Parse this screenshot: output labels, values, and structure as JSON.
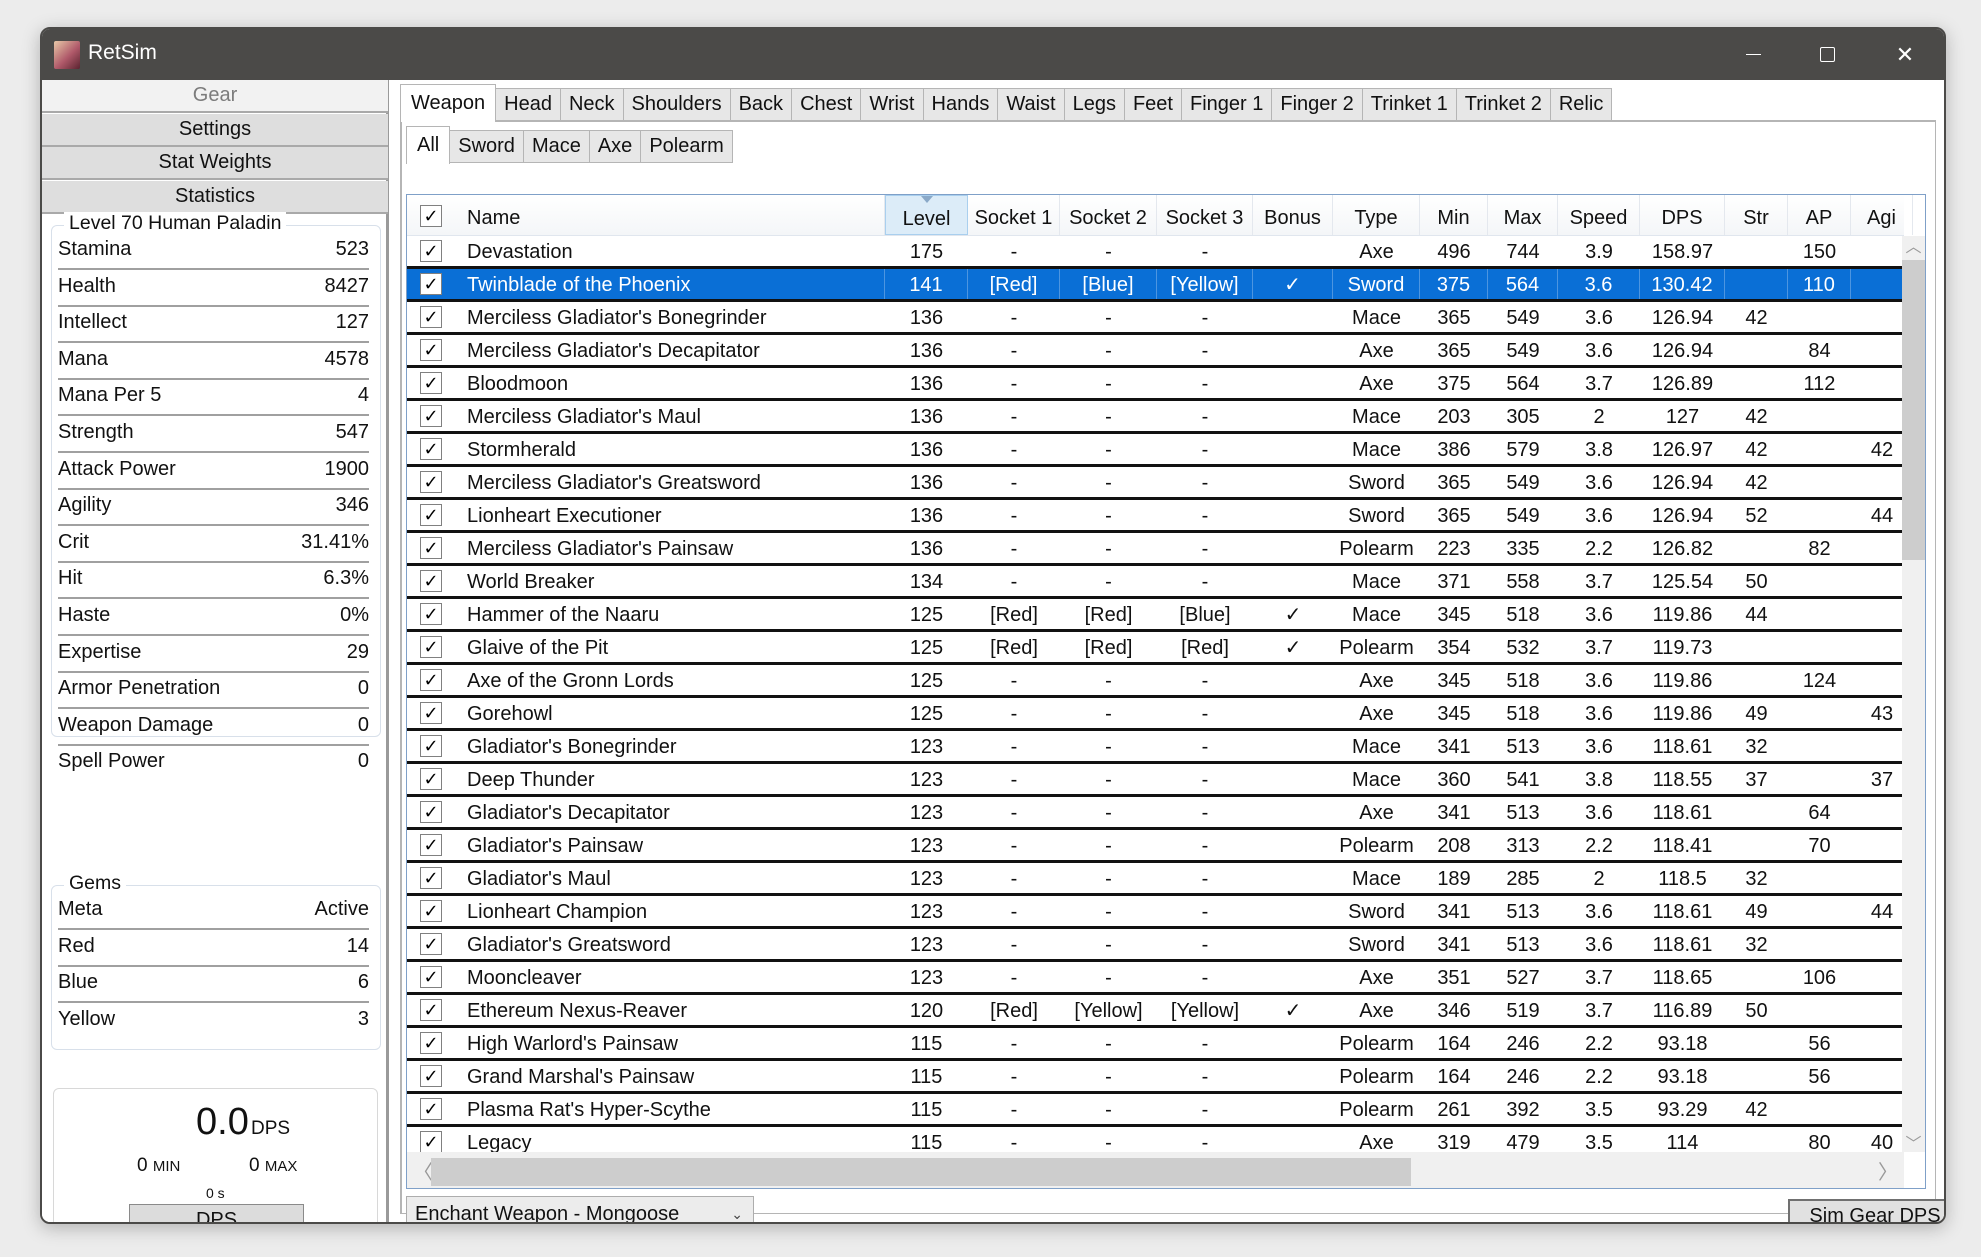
{
  "window": {
    "title": "RetSim",
    "controls": [
      "minimize",
      "maximize",
      "close"
    ]
  },
  "sidebar": {
    "nav": [
      {
        "label": "Gear",
        "active": true
      },
      {
        "label": "Settings",
        "active": false
      },
      {
        "label": "Stat Weights",
        "active": false
      },
      {
        "label": "Statistics",
        "active": false
      }
    ],
    "character": {
      "title": "Level 70 Human Paladin",
      "stats": [
        {
          "label": "Stamina",
          "value": "523"
        },
        {
          "label": "Health",
          "value": "8427"
        },
        {
          "label": "Intellect",
          "value": "127"
        },
        {
          "label": "Mana",
          "value": "4578"
        },
        {
          "label": "Mana Per 5",
          "value": "4"
        },
        {
          "label": "Strength",
          "value": "547"
        },
        {
          "label": "Attack Power",
          "value": "1900"
        },
        {
          "label": "Agility",
          "value": "346"
        },
        {
          "label": "Crit",
          "value": "31.41%"
        },
        {
          "label": "Hit",
          "value": "6.3%"
        },
        {
          "label": "Haste",
          "value": "0%"
        },
        {
          "label": "Expertise",
          "value": "29"
        },
        {
          "label": "Armor Penetration",
          "value": "0"
        },
        {
          "label": "Weapon Damage",
          "value": "0"
        },
        {
          "label": "Spell Power",
          "value": "0"
        }
      ]
    },
    "gems": {
      "title": "Gems",
      "rows": [
        {
          "label": "Meta",
          "value": "Active"
        },
        {
          "label": "Red",
          "value": "14"
        },
        {
          "label": "Blue",
          "value": "6"
        },
        {
          "label": "Yellow",
          "value": "3"
        }
      ]
    },
    "dps": {
      "value": "0.0",
      "unit": "DPS",
      "min": "0",
      "min_label": "MIN",
      "max": "0",
      "max_label": "MAX",
      "time": "0 s",
      "button_label": "DPS"
    }
  },
  "main": {
    "slot_tabs": [
      {
        "label": "Weapon",
        "active": true
      },
      {
        "label": "Head"
      },
      {
        "label": "Neck"
      },
      {
        "label": "Shoulders"
      },
      {
        "label": "Back"
      },
      {
        "label": "Chest"
      },
      {
        "label": "Wrist"
      },
      {
        "label": "Hands"
      },
      {
        "label": "Waist"
      },
      {
        "label": "Legs"
      },
      {
        "label": "Feet"
      },
      {
        "label": "Finger 1"
      },
      {
        "label": "Finger 2"
      },
      {
        "label": "Trinket 1"
      },
      {
        "label": "Trinket 2"
      },
      {
        "label": "Relic"
      }
    ],
    "type_tabs": [
      {
        "label": "All",
        "active": true
      },
      {
        "label": "Sword"
      },
      {
        "label": "Mace"
      },
      {
        "label": "Axe"
      },
      {
        "label": "Polearm"
      }
    ],
    "table": {
      "header_checked": true,
      "sorted_column": "Level",
      "columns": [
        "Name",
        "Level",
        "Socket 1",
        "Socket 2",
        "Socket 3",
        "Bonus",
        "Type",
        "Min",
        "Max",
        "Speed",
        "DPS",
        "Str",
        "AP",
        "Agi"
      ],
      "selected_index": 1,
      "rows": [
        {
          "checked": true,
          "cells": [
            "Devastation",
            "175",
            "-",
            "-",
            "-",
            "",
            "Axe",
            "496",
            "744",
            "3.9",
            "158.97",
            "",
            "150",
            ""
          ]
        },
        {
          "checked": true,
          "cells": [
            "Twinblade of the Phoenix",
            "141",
            "[Red]",
            "[Blue]",
            "[Yellow]",
            "✓",
            "Sword",
            "375",
            "564",
            "3.6",
            "130.42",
            "",
            "110",
            ""
          ]
        },
        {
          "checked": true,
          "cells": [
            "Merciless Gladiator's Bonegrinder",
            "136",
            "-",
            "-",
            "-",
            "",
            "Mace",
            "365",
            "549",
            "3.6",
            "126.94",
            "42",
            "",
            ""
          ]
        },
        {
          "checked": true,
          "cells": [
            "Merciless Gladiator's Decapitator",
            "136",
            "-",
            "-",
            "-",
            "",
            "Axe",
            "365",
            "549",
            "3.6",
            "126.94",
            "",
            "84",
            ""
          ]
        },
        {
          "checked": true,
          "cells": [
            "Bloodmoon",
            "136",
            "-",
            "-",
            "-",
            "",
            "Axe",
            "375",
            "564",
            "3.7",
            "126.89",
            "",
            "112",
            ""
          ]
        },
        {
          "checked": true,
          "cells": [
            "Merciless Gladiator's Maul",
            "136",
            "-",
            "-",
            "-",
            "",
            "Mace",
            "203",
            "305",
            "2",
            "127",
            "42",
            "",
            ""
          ]
        },
        {
          "checked": true,
          "cells": [
            "Stormherald",
            "136",
            "-",
            "-",
            "-",
            "",
            "Mace",
            "386",
            "579",
            "3.8",
            "126.97",
            "42",
            "",
            "42"
          ]
        },
        {
          "checked": true,
          "cells": [
            "Merciless Gladiator's Greatsword",
            "136",
            "-",
            "-",
            "-",
            "",
            "Sword",
            "365",
            "549",
            "3.6",
            "126.94",
            "42",
            "",
            ""
          ]
        },
        {
          "checked": true,
          "cells": [
            "Lionheart Executioner",
            "136",
            "-",
            "-",
            "-",
            "",
            "Sword",
            "365",
            "549",
            "3.6",
            "126.94",
            "52",
            "",
            "44"
          ]
        },
        {
          "checked": true,
          "cells": [
            "Merciless Gladiator's Painsaw",
            "136",
            "-",
            "-",
            "-",
            "",
            "Polearm",
            "223",
            "335",
            "2.2",
            "126.82",
            "",
            "82",
            ""
          ]
        },
        {
          "checked": true,
          "cells": [
            "World Breaker",
            "134",
            "-",
            "-",
            "-",
            "",
            "Mace",
            "371",
            "558",
            "3.7",
            "125.54",
            "50",
            "",
            ""
          ]
        },
        {
          "checked": true,
          "cells": [
            "Hammer of the Naaru",
            "125",
            "[Red]",
            "[Red]",
            "[Blue]",
            "✓",
            "Mace",
            "345",
            "518",
            "3.6",
            "119.86",
            "44",
            "",
            ""
          ]
        },
        {
          "checked": true,
          "cells": [
            "Glaive of the Pit",
            "125",
            "[Red]",
            "[Red]",
            "[Red]",
            "✓",
            "Polearm",
            "354",
            "532",
            "3.7",
            "119.73",
            "",
            "",
            ""
          ]
        },
        {
          "checked": true,
          "cells": [
            "Axe of the Gronn Lords",
            "125",
            "-",
            "-",
            "-",
            "",
            "Axe",
            "345",
            "518",
            "3.6",
            "119.86",
            "",
            "124",
            ""
          ]
        },
        {
          "checked": true,
          "cells": [
            "Gorehowl",
            "125",
            "-",
            "-",
            "-",
            "",
            "Axe",
            "345",
            "518",
            "3.6",
            "119.86",
            "49",
            "",
            "43"
          ]
        },
        {
          "checked": true,
          "cells": [
            "Gladiator's Bonegrinder",
            "123",
            "-",
            "-",
            "-",
            "",
            "Mace",
            "341",
            "513",
            "3.6",
            "118.61",
            "32",
            "",
            ""
          ]
        },
        {
          "checked": true,
          "cells": [
            "Deep Thunder",
            "123",
            "-",
            "-",
            "-",
            "",
            "Mace",
            "360",
            "541",
            "3.8",
            "118.55",
            "37",
            "",
            "37"
          ]
        },
        {
          "checked": true,
          "cells": [
            "Gladiator's Decapitator",
            "123",
            "-",
            "-",
            "-",
            "",
            "Axe",
            "341",
            "513",
            "3.6",
            "118.61",
            "",
            "64",
            ""
          ]
        },
        {
          "checked": true,
          "cells": [
            "Gladiator's Painsaw",
            "123",
            "-",
            "-",
            "-",
            "",
            "Polearm",
            "208",
            "313",
            "2.2",
            "118.41",
            "",
            "70",
            ""
          ]
        },
        {
          "checked": true,
          "cells": [
            "Gladiator's Maul",
            "123",
            "-",
            "-",
            "-",
            "",
            "Mace",
            "189",
            "285",
            "2",
            "118.5",
            "32",
            "",
            ""
          ]
        },
        {
          "checked": true,
          "cells": [
            "Lionheart Champion",
            "123",
            "-",
            "-",
            "-",
            "",
            "Sword",
            "341",
            "513",
            "3.6",
            "118.61",
            "49",
            "",
            "44"
          ]
        },
        {
          "checked": true,
          "cells": [
            "Gladiator's Greatsword",
            "123",
            "-",
            "-",
            "-",
            "",
            "Sword",
            "341",
            "513",
            "3.6",
            "118.61",
            "32",
            "",
            ""
          ]
        },
        {
          "checked": true,
          "cells": [
            "Mooncleaver",
            "123",
            "-",
            "-",
            "-",
            "",
            "Axe",
            "351",
            "527",
            "3.7",
            "118.65",
            "",
            "106",
            ""
          ]
        },
        {
          "checked": true,
          "cells": [
            "Ethereum Nexus-Reaver",
            "120",
            "[Red]",
            "[Yellow]",
            "[Yellow]",
            "✓",
            "Axe",
            "346",
            "519",
            "3.7",
            "116.89",
            "50",
            "",
            ""
          ]
        },
        {
          "checked": true,
          "cells": [
            "High Warlord's Painsaw",
            "115",
            "-",
            "-",
            "-",
            "",
            "Polearm",
            "164",
            "246",
            "2.2",
            "93.18",
            "",
            "56",
            ""
          ]
        },
        {
          "checked": true,
          "cells": [
            "Grand Marshal's Painsaw",
            "115",
            "-",
            "-",
            "-",
            "",
            "Polearm",
            "164",
            "246",
            "2.2",
            "93.18",
            "",
            "56",
            ""
          ]
        },
        {
          "checked": true,
          "cells": [
            "Plasma Rat's Hyper-Scythe",
            "115",
            "-",
            "-",
            "-",
            "",
            "Polearm",
            "261",
            "392",
            "3.5",
            "93.29",
            "42",
            "",
            ""
          ]
        },
        {
          "checked": true,
          "cells": [
            "Legacy",
            "115",
            "-",
            "-",
            "-",
            "",
            "Axe",
            "319",
            "479",
            "3.5",
            "114",
            "",
            "80",
            "40"
          ]
        }
      ]
    },
    "enchant_select": {
      "value": "Enchant Weapon - Mongoose"
    },
    "sim_button_label": "Sim Gear DPS"
  },
  "colors": {
    "titlebar": "#4b4a48",
    "selection": "#0a6fd6",
    "sorted_header": "#dcecf8"
  }
}
